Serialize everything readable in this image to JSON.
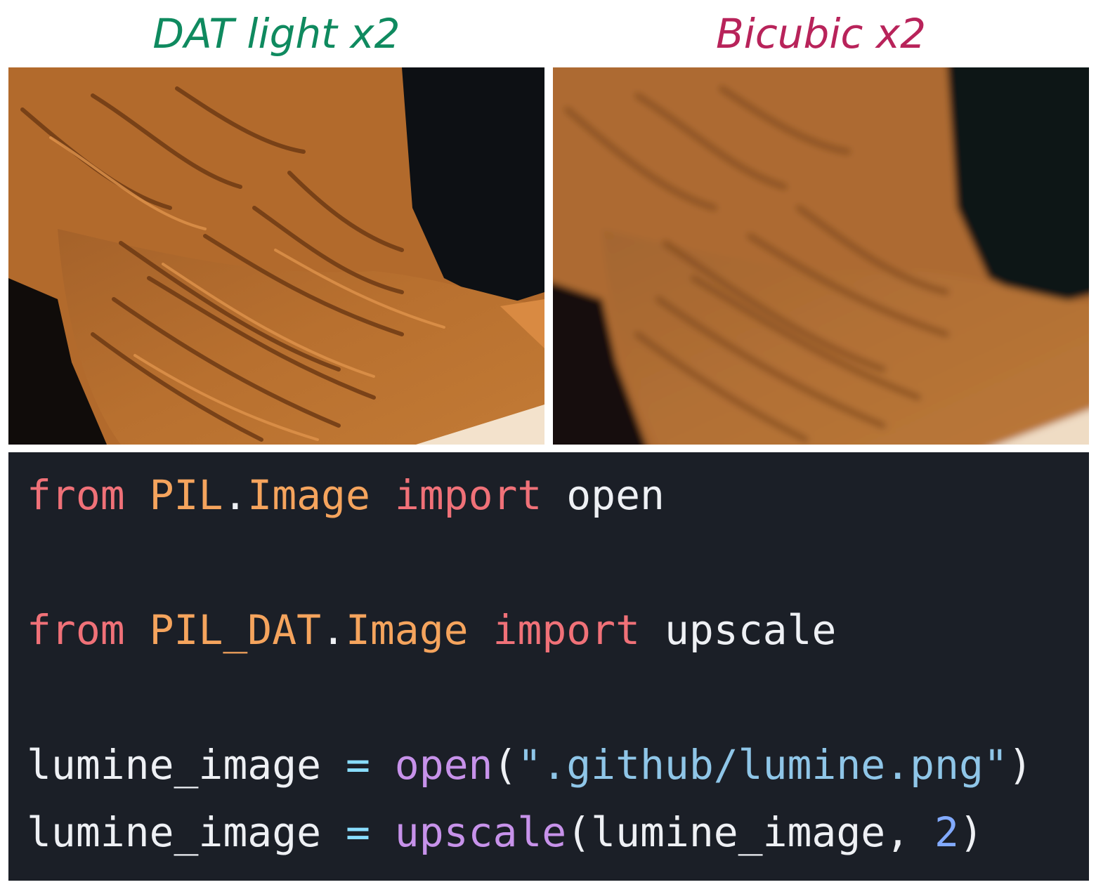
{
  "labels": {
    "left": "DAT light x2",
    "right": "Bicubic x2",
    "left_color": "#0f8a5f",
    "right_color": "#b8235a"
  },
  "code": {
    "background": "#1b1f27",
    "colors": {
      "keyword": "#f07178",
      "module": "#f5a45d",
      "identifier": "#eef0f4",
      "function": "#c792ea",
      "string": "#8fc6e8",
      "number": "#82aaff",
      "operator": "#89ddff"
    },
    "line1": {
      "kw_from": "from",
      "module": "PIL",
      "dot": ".",
      "submodule": "Image",
      "kw_import": "import",
      "name": "open"
    },
    "line2": {
      "kw_from": "from",
      "module": "PIL_DAT",
      "dot": ".",
      "submodule": "Image",
      "kw_import": "import",
      "name": "upscale"
    },
    "line3": {
      "var": "lumine_image",
      "op": "=",
      "func": "open",
      "paren_open": "(",
      "string": "\".github/lumine.png\"",
      "paren_close": ")"
    },
    "line4": {
      "var": "lumine_image",
      "op": "=",
      "func": "upscale",
      "paren_open": "(",
      "arg": "lumine_image",
      "comma": ",",
      "number": "2",
      "paren_close": ")"
    }
  }
}
